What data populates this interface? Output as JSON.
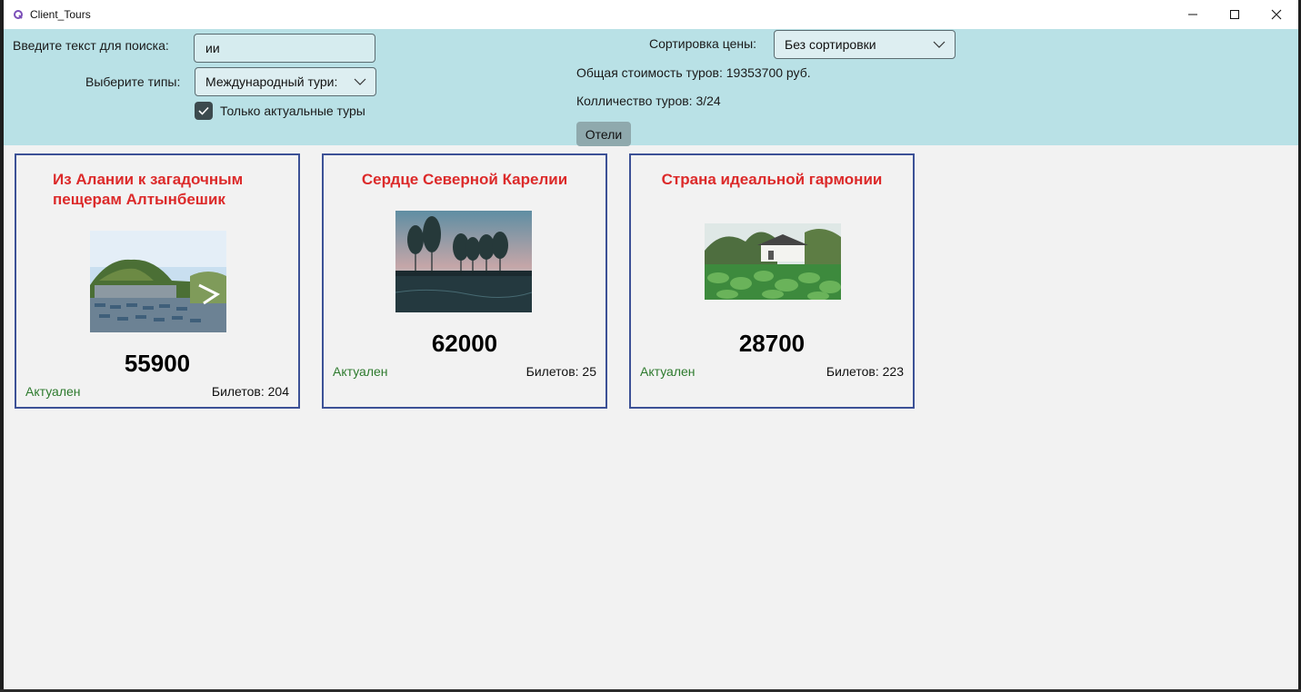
{
  "window": {
    "title": "Client_Tours",
    "controls": {
      "minimize": "minimize-icon",
      "maximize": "maximize-icon",
      "close": "close-icon"
    }
  },
  "filters": {
    "search_label": "Введите текст для поиска:",
    "search_value": "ии",
    "types_label": "Выберите типы:",
    "types_selected": "Международный тури:",
    "actual_only_label": "Только актуальные туры",
    "actual_only_checked": true,
    "sort_label": "Сортировка цены:",
    "sort_selected": "Без сортировки",
    "total_cost": "Общая стоимость туров: 19353700 руб.",
    "tour_count": "Колличество туров: 3/24",
    "hotels_button": "Отели"
  },
  "colors": {
    "panel_bg": "#b9e1e6",
    "title_red": "#dc2a2a",
    "status_green": "#2d7a2d",
    "card_border": "#3c5196"
  },
  "tours": [
    {
      "title_line1": "Из Алании к загадочным",
      "title_line2": "пещерам Алтынбешик",
      "price": "55900",
      "status": "Актуален",
      "tickets": "Билетов: 204"
    },
    {
      "title_line1": "Сердце Северной Карелии",
      "title_line2": "",
      "price": "62000",
      "status": "Актуален",
      "tickets": "Билетов: 25"
    },
    {
      "title_line1": "Страна идеальной гармонии",
      "title_line2": "",
      "price": "28700",
      "status": "Актуален",
      "tickets": "Билетов: 223"
    }
  ]
}
